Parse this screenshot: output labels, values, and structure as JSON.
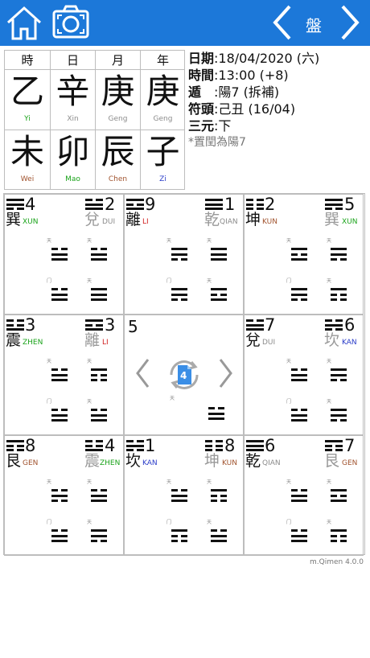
{
  "title": "盤",
  "icons": {
    "home": "home-icon",
    "camera": "camera-icon",
    "prev": "chevron-left-icon",
    "next": "chevron-right-icon",
    "rotate": "rotate-icon"
  },
  "colors": {
    "topbar": "#1c78d9",
    "wood": "#1aa31a",
    "metal": "#8c8c8c",
    "fire": "#d02020",
    "earth": "#a0522d",
    "water": "#2a3cc8"
  },
  "pillars": {
    "headers": [
      "時",
      "日",
      "月",
      "年"
    ],
    "stems": [
      {
        "ch": "乙",
        "py": "Yi"
      },
      {
        "ch": "辛",
        "py": "Xin"
      },
      {
        "ch": "庚",
        "py": "Geng"
      },
      {
        "ch": "庚",
        "py": "Geng"
      }
    ],
    "branches": [
      {
        "ch": "未",
        "py": "Wei"
      },
      {
        "ch": "卯",
        "py": "Mao"
      },
      {
        "ch": "辰",
        "py": "Chen"
      },
      {
        "ch": "子",
        "py": "Zi"
      }
    ]
  },
  "info": {
    "date_label": "日期",
    "date_value": ":18/04/2020 (六)",
    "time_label": "時間",
    "time_value": ":13:00 (+8)",
    "dun_label": "遁",
    "dun_value": "　:陽7 (拆補)",
    "fu_label": "符頭",
    "fu_value": ":己丑 (16/04)",
    "yuan_label": "三元",
    "yuan_value": ":下",
    "note": "*置閏為陽7"
  },
  "palaces": [
    {
      "lnum": "4",
      "lname": "巽",
      "lpy": "XUN",
      "rnum": "2",
      "rname": "兌",
      "rpy": "DUI"
    },
    {
      "lnum": "9",
      "lname": "離",
      "lpy": "LI",
      "rnum": "1",
      "rname": "乾",
      "rpy": "QIAN"
    },
    {
      "lnum": "2",
      "lname": "坤",
      "lpy": "KUN",
      "rnum": "5",
      "rname": "巽",
      "rpy": "XUN"
    },
    {
      "lnum": "3",
      "lname": "震",
      "lpy": "ZHEN",
      "rnum": "3",
      "rname": "離",
      "rpy": "LI"
    },
    {
      "center": "5",
      "badge": "4"
    },
    {
      "lnum": "7",
      "lname": "兌",
      "lpy": "DUI",
      "rnum": "6",
      "rname": "坎",
      "rpy": "KAN"
    },
    {
      "lnum": "8",
      "lname": "艮",
      "lpy": "GEN",
      "rnum": "4",
      "rname": "震",
      "rpy": "ZHEN"
    },
    {
      "lnum": "1",
      "lname": "坎",
      "lpy": "KAN",
      "rnum": "8",
      "rname": "坤",
      "rpy": "KUN"
    },
    {
      "lnum": "6",
      "lname": "乾",
      "lpy": "QIAN",
      "rnum": "7",
      "rname": "艮",
      "rpy": "GEN"
    }
  ],
  "small_marks": {
    "tian": "天",
    "men": "门"
  },
  "version": "m.Qimen 4.0.0"
}
